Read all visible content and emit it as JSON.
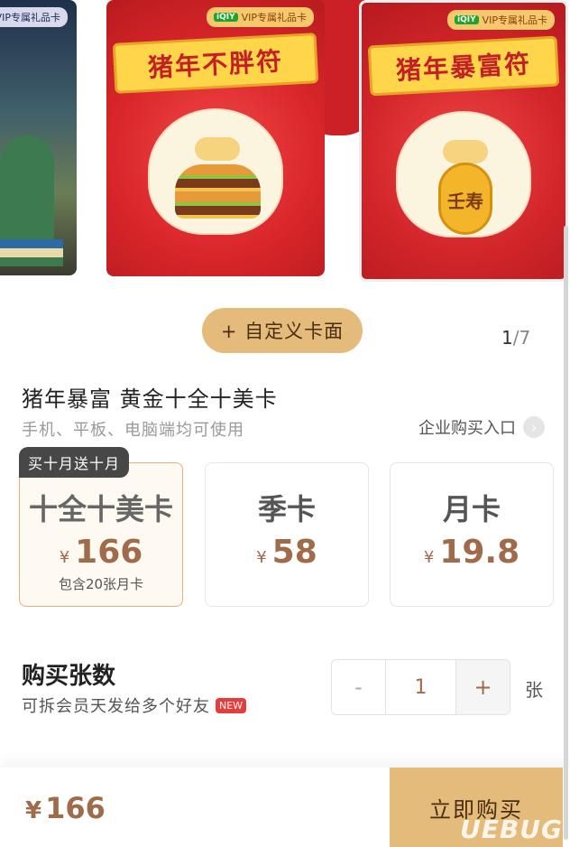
{
  "carousel": {
    "cards": [
      {
        "tag": "VIP专属礼品卡",
        "banner": ""
      },
      {
        "tag": "VIP专属礼品卡",
        "banner": "猪年不胖符"
      },
      {
        "tag": "VIP专属礼品卡",
        "banner": "猪年暴富符",
        "coin_text": "壬寿"
      }
    ],
    "tag_brand": "iQIY",
    "custom_button": "+ 自定义卡面",
    "page_current": "1",
    "page_total": "/7"
  },
  "product": {
    "title": "猪年暴富 黄金十全十美卡",
    "subtitle": "手机、平板、电脑端均可使用",
    "enterprise_link": "企业购买入口"
  },
  "plans": [
    {
      "ribbon": "买十月送十月",
      "name": "十全十美卡",
      "currency": "¥",
      "price": "166",
      "note": "包含20张月卡",
      "selected": true
    },
    {
      "name": "季卡",
      "currency": "¥",
      "price": "58",
      "note": ""
    },
    {
      "name": "月卡",
      "currency": "¥",
      "price": "19.8",
      "note": ""
    }
  ],
  "quantity": {
    "title": "购买张数",
    "subtitle": "可拆会员天发给多个好友",
    "new_badge": "NEW",
    "minus": "-",
    "value": "1",
    "plus": "+",
    "unit": "张"
  },
  "footer": {
    "currency": "¥",
    "total": "166",
    "buy_button": "立即购买",
    "watermark": "UEBUG"
  },
  "colors": {
    "accent": "#e4bb7a",
    "price": "#a06b4a",
    "red": "#d9262a"
  }
}
